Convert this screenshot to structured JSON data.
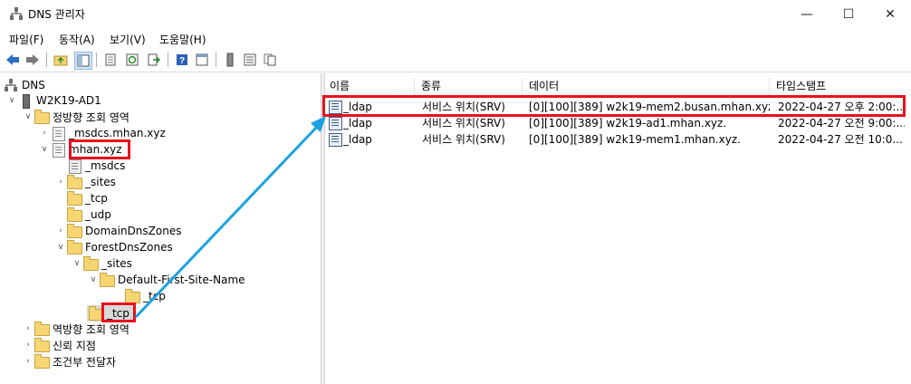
{
  "window": {
    "title": "DNS 관리자"
  },
  "menu": [
    "파일(F)",
    "동작(A)",
    "보기(V)",
    "도움말(H)"
  ],
  "toolbar": [
    "back-icon",
    "forward-icon",
    "up-folder-icon",
    "show-hide-tree-icon",
    "properties-icon",
    "refresh-icon",
    "export-list-icon",
    "help-icon",
    "show-console-icon",
    "server-icon",
    "list-icon",
    "copy-icon"
  ],
  "tree": {
    "root": "DNS",
    "server": "W2K19-AD1",
    "forward_zones": "정방향 조회 영역",
    "msdcs_zone": "_msdcs.mhan.xyz",
    "mhan_zone": "mhan.xyz",
    "msdcs": "_msdcs",
    "sites": "_sites",
    "tcp": "_tcp",
    "udp": "_udp",
    "domain_dns_zones": "DomainDnsZones",
    "forest_dns_zones": "ForestDnsZones",
    "forest_sites": "_sites",
    "default_site": "Default-First-Site-Name",
    "site_tcp": "_tcp",
    "forest_tcp": "_tcp",
    "reverse_zones": "역방향 조회 영역",
    "trust_points": "신뢰 지점",
    "conditional_forwarders": "조건부 전달자"
  },
  "list": {
    "columns": [
      "이름",
      "종류",
      "데이터",
      "타임스탬프"
    ],
    "rows": [
      {
        "name": "_ldap",
        "type": "서비스 위치(SRV)",
        "data": "[0][100][389] w2k19-mem2.busan.mhan.xyz.",
        "timestamp": "2022-04-27 오후 2:00:..."
      },
      {
        "name": "_ldap",
        "type": "서비스 위치(SRV)",
        "data": "[0][100][389] w2k19-ad1.mhan.xyz.",
        "timestamp": "2022-04-27 오전 9:00:..."
      },
      {
        "name": "_ldap",
        "type": "서비스 위치(SRV)",
        "data": "[0][100][389] w2k19-mem1.mhan.xyz.",
        "timestamp": "2022-04-27 오전 10:0..."
      }
    ]
  },
  "colors": {
    "highlight_red": "#e8101d",
    "arrow_blue": "#1aa3e0",
    "folder": "#f6d573"
  }
}
